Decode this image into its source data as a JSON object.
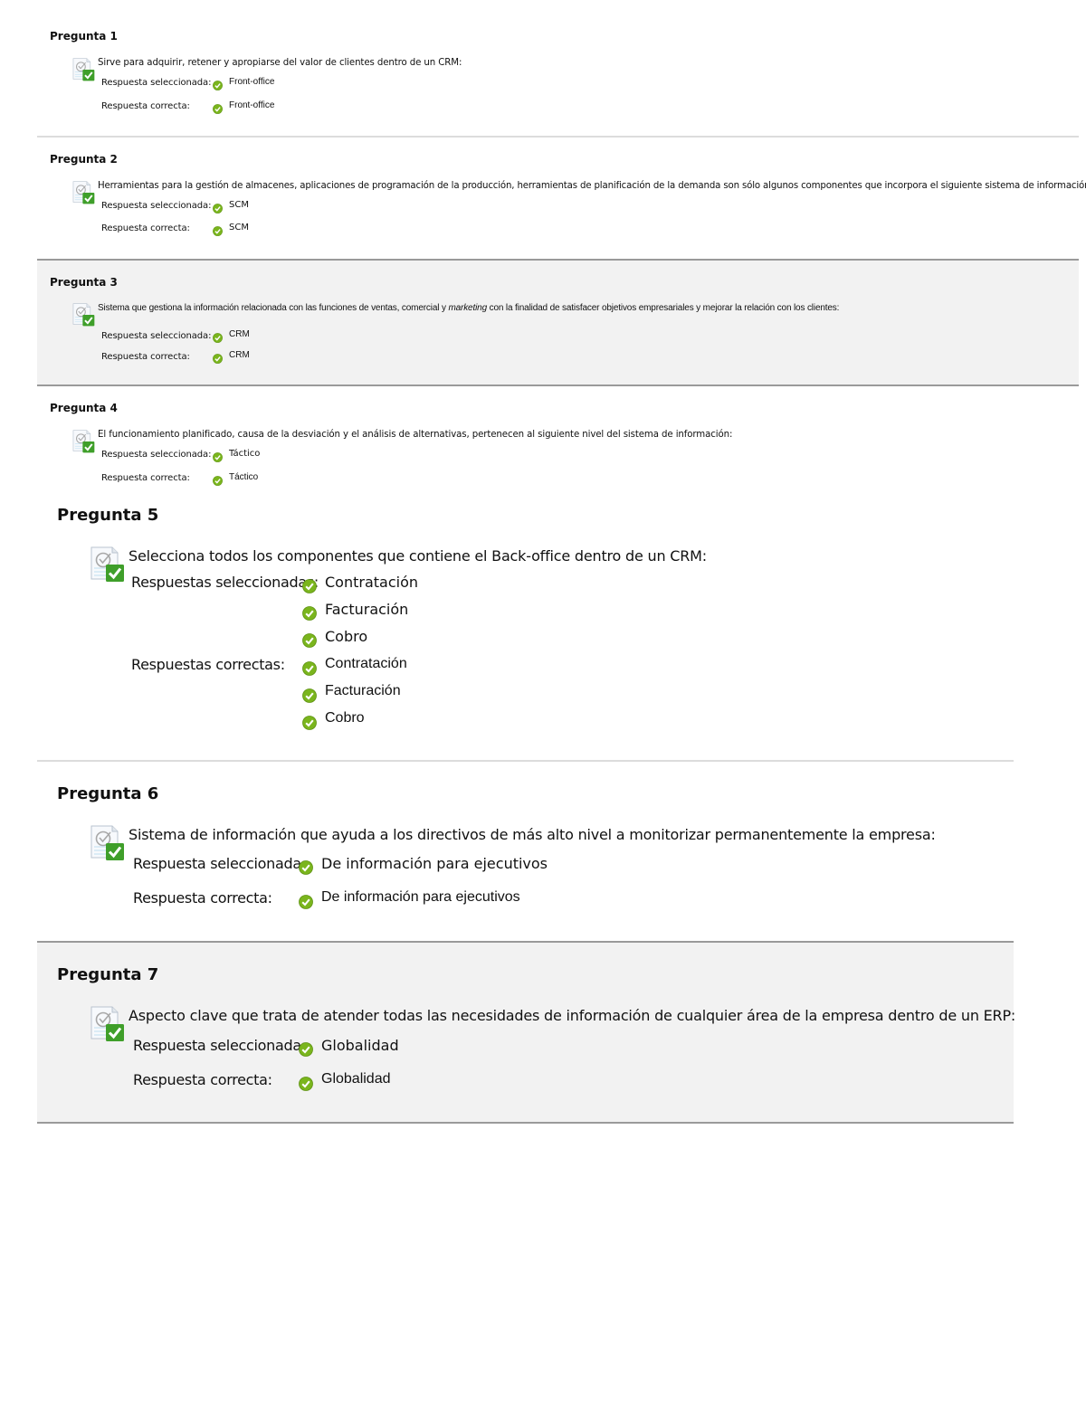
{
  "labels": {
    "selected_single": "Respuesta seleccionada:",
    "correct_single": "Respuesta correcta:",
    "selected_multi": "Respuestas seleccionadas:",
    "correct_multi": "Respuestas correctas:"
  },
  "colors": {
    "check_green": "#7ab51d",
    "icon_badge_green": "#3f9f2a",
    "alt_row_background": "#f2f2f2",
    "divider_light": "#dcdcdc",
    "divider_dark": "#9a9a9a"
  },
  "questions": [
    {
      "title": "Pregunta 1",
      "text": "Sirve para adquirir, retener y apropiarse del valor de clientes dentro de un CRM:",
      "selected": [
        "Front-office"
      ],
      "correct": [
        "Front-office"
      ],
      "status_icon": "question-correct-icon"
    },
    {
      "title": "Pregunta 2",
      "text": "Herramientas para la gestión de almacenes, aplicaciones de programación de la producción, herramientas de planificación de la demanda son sólo algunos componentes que incorpora el siguiente sistema de información:",
      "selected": [
        "SCM"
      ],
      "correct": [
        "SCM"
      ],
      "status_icon": "question-correct-icon"
    },
    {
      "title": "Pregunta 3",
      "text_before": "Sistema que gestiona la información relacionada con las funciones de ventas, comercial y ",
      "text_italic": "marketing",
      "text_after": " con la finalidad de satisfacer objetivos empresariales y mejorar la relación con los clientes:",
      "selected": [
        "CRM"
      ],
      "correct": [
        "CRM"
      ],
      "status_icon": "question-correct-icon"
    },
    {
      "title": "Pregunta 4",
      "text": "El funcionamiento planificado, causa de la desviación y el análisis de alternativas, pertenecen al siguiente nivel del sistema de información:",
      "selected": [
        "Táctico"
      ],
      "correct": [
        "Táctico"
      ],
      "status_icon": "question-correct-icon"
    },
    {
      "title": "Pregunta 5",
      "text": "Selecciona todos los componentes que contiene el Back-office dentro de un CRM:",
      "selected": [
        "Contratación",
        "Facturación",
        "Cobro"
      ],
      "correct": [
        "Contratación",
        "Facturación",
        "Cobro"
      ],
      "status_icon": "question-correct-icon"
    },
    {
      "title": "Pregunta 6",
      "text": "Sistema de información que ayuda a los directivos de más alto nivel a monitorizar permanentemente la empresa:",
      "selected": [
        "De información para ejecutivos"
      ],
      "correct": [
        "De información para ejecutivos"
      ],
      "status_icon": "question-correct-icon"
    },
    {
      "title": "Pregunta 7",
      "text": "Aspecto clave que trata de atender todas las necesidades de información de cualquier área de la empresa dentro de un ERP:",
      "selected": [
        "Globalidad"
      ],
      "correct": [
        "Globalidad"
      ],
      "status_icon": "question-correct-icon"
    }
  ]
}
